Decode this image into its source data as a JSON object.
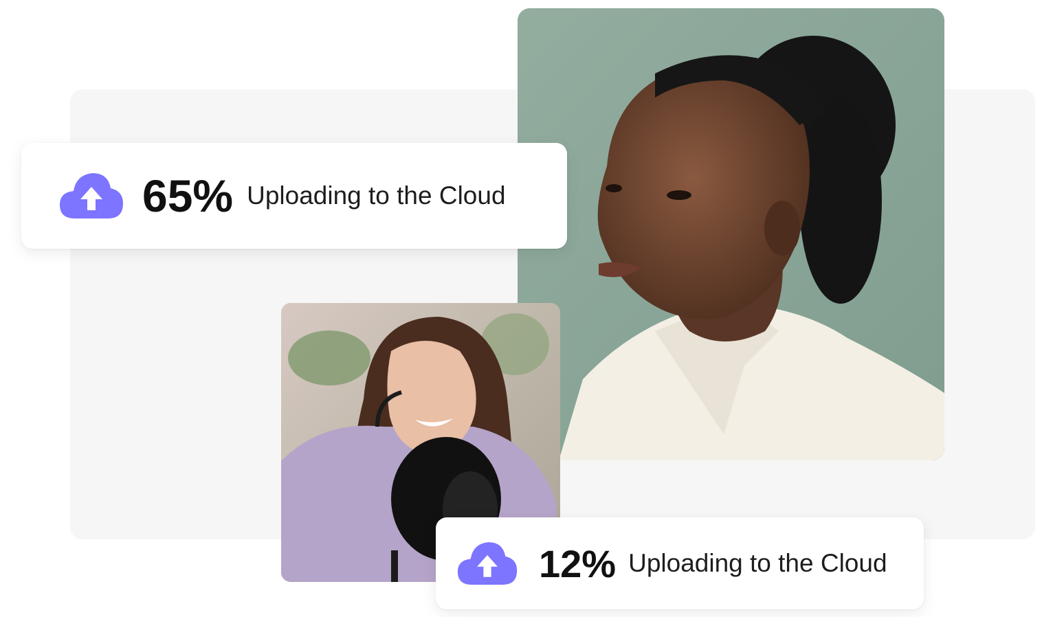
{
  "colors": {
    "accent": "#7d74ff",
    "backdrop": "#f6f6f6",
    "card_bg": "#ffffff",
    "text_primary": "#111111"
  },
  "upload_cards": [
    {
      "icon": "cloud-upload-icon",
      "percent_label": "65%",
      "progress": 0.65,
      "status_text": "Uploading to the Cloud"
    },
    {
      "icon": "cloud-upload-icon",
      "percent_label": "12%",
      "progress": 0.12,
      "status_text": "Uploading to the Cloud"
    }
  ],
  "photos": [
    {
      "name": "portrait-photo"
    },
    {
      "name": "podcast-photo"
    }
  ]
}
